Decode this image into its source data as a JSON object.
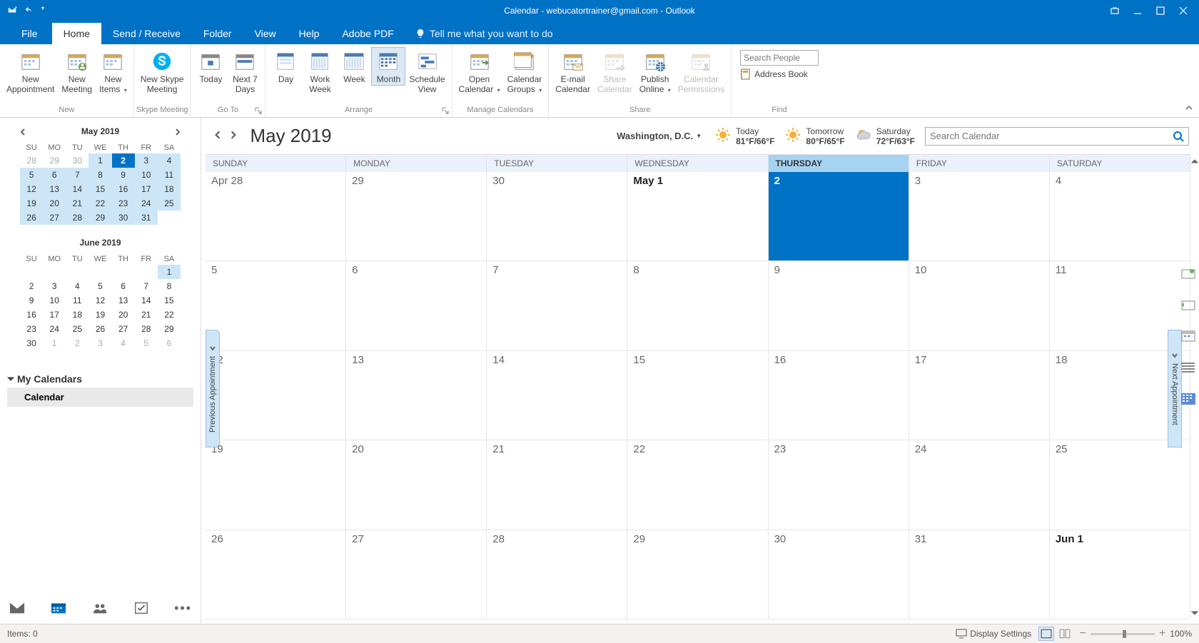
{
  "titlebar": {
    "title": "Calendar - webucatortrainer@gmail.com  -  Outlook"
  },
  "menu": {
    "tabs": [
      "File",
      "Home",
      "Send / Receive",
      "Folder",
      "View",
      "Help",
      "Adobe PDF"
    ],
    "active": 1,
    "tellme_placeholder": "Tell me what you want to do"
  },
  "ribbon": {
    "groups": {
      "new": {
        "label": "New",
        "buttons": [
          {
            "label": "New\nAppointment"
          },
          {
            "label": "New\nMeeting"
          },
          {
            "label": "New\nItems",
            "dropdown": true
          }
        ]
      },
      "skype": {
        "label": "Skype Meeting",
        "buttons": [
          {
            "label": "New Skype\nMeeting"
          }
        ]
      },
      "goto": {
        "label": "Go To",
        "buttons": [
          {
            "label": "Today"
          },
          {
            "label": "Next 7\nDays"
          }
        ]
      },
      "arrange": {
        "label": "Arrange",
        "buttons": [
          {
            "label": "Day"
          },
          {
            "label": "Work\nWeek"
          },
          {
            "label": "Week"
          },
          {
            "label": "Month",
            "selected": true
          },
          {
            "label": "Schedule\nView"
          }
        ]
      },
      "manage": {
        "label": "Manage Calendars",
        "buttons": [
          {
            "label": "Open\nCalendar",
            "dropdown": true
          },
          {
            "label": "Calendar\nGroups",
            "dropdown": true
          }
        ]
      },
      "share": {
        "label": "Share",
        "buttons": [
          {
            "label": "E-mail\nCalendar"
          },
          {
            "label": "Share\nCalendar",
            "disabled": true
          },
          {
            "label": "Publish\nOnline",
            "dropdown": true
          },
          {
            "label": "Calendar\nPermissions",
            "disabled": true
          }
        ]
      },
      "find": {
        "label": "Find",
        "search_placeholder": "Search People",
        "address_book": "Address Book"
      }
    }
  },
  "mini_cals": [
    {
      "title": "May 2019",
      "show_nav": true,
      "dow": [
        "SU",
        "MO",
        "TU",
        "WE",
        "TH",
        "FR",
        "SA"
      ],
      "weeks": [
        [
          {
            "d": "28",
            "oom": true
          },
          {
            "d": "29",
            "oom": true
          },
          {
            "d": "30",
            "oom": true
          },
          {
            "d": "1",
            "in": true
          },
          {
            "d": "2",
            "in": true,
            "today": true
          },
          {
            "d": "3",
            "in": true
          },
          {
            "d": "4",
            "in": true
          }
        ],
        [
          {
            "d": "5",
            "in": true
          },
          {
            "d": "6",
            "in": true
          },
          {
            "d": "7",
            "in": true
          },
          {
            "d": "8",
            "in": true
          },
          {
            "d": "9",
            "in": true
          },
          {
            "d": "10",
            "in": true
          },
          {
            "d": "11",
            "in": true
          }
        ],
        [
          {
            "d": "12",
            "in": true
          },
          {
            "d": "13",
            "in": true
          },
          {
            "d": "14",
            "in": true
          },
          {
            "d": "15",
            "in": true
          },
          {
            "d": "16",
            "in": true
          },
          {
            "d": "17",
            "in": true
          },
          {
            "d": "18",
            "in": true
          }
        ],
        [
          {
            "d": "19",
            "in": true
          },
          {
            "d": "20",
            "in": true
          },
          {
            "d": "21",
            "in": true
          },
          {
            "d": "22",
            "in": true
          },
          {
            "d": "23",
            "in": true
          },
          {
            "d": "24",
            "in": true
          },
          {
            "d": "25",
            "in": true
          }
        ],
        [
          {
            "d": "26",
            "in": true
          },
          {
            "d": "27",
            "in": true
          },
          {
            "d": "28",
            "in": true
          },
          {
            "d": "29",
            "in": true
          },
          {
            "d": "30",
            "in": true
          },
          {
            "d": "31",
            "in": true
          },
          {
            "d": ""
          }
        ]
      ]
    },
    {
      "title": "June 2019",
      "show_nav": false,
      "dow": [
        "SU",
        "MO",
        "TU",
        "WE",
        "TH",
        "FR",
        "SA"
      ],
      "weeks": [
        [
          {
            "d": ""
          },
          {
            "d": ""
          },
          {
            "d": ""
          },
          {
            "d": ""
          },
          {
            "d": ""
          },
          {
            "d": ""
          },
          {
            "d": "1",
            "in": true
          }
        ],
        [
          {
            "d": "2"
          },
          {
            "d": "3"
          },
          {
            "d": "4"
          },
          {
            "d": "5"
          },
          {
            "d": "6"
          },
          {
            "d": "7"
          },
          {
            "d": "8"
          }
        ],
        [
          {
            "d": "9"
          },
          {
            "d": "10"
          },
          {
            "d": "11"
          },
          {
            "d": "12"
          },
          {
            "d": "13"
          },
          {
            "d": "14"
          },
          {
            "d": "15"
          }
        ],
        [
          {
            "d": "16"
          },
          {
            "d": "17"
          },
          {
            "d": "18"
          },
          {
            "d": "19"
          },
          {
            "d": "20"
          },
          {
            "d": "21"
          },
          {
            "d": "22"
          }
        ],
        [
          {
            "d": "23"
          },
          {
            "d": "24"
          },
          {
            "d": "25"
          },
          {
            "d": "26"
          },
          {
            "d": "27"
          },
          {
            "d": "28"
          },
          {
            "d": "29"
          }
        ],
        [
          {
            "d": "30"
          },
          {
            "d": "1",
            "oom": true
          },
          {
            "d": "2",
            "oom": true
          },
          {
            "d": "3",
            "oom": true
          },
          {
            "d": "4",
            "oom": true
          },
          {
            "d": "5",
            "oom": true
          },
          {
            "d": "6",
            "oom": true
          }
        ]
      ]
    }
  ],
  "mycals": {
    "header": "My Calendars",
    "items": [
      "Calendar"
    ]
  },
  "cal": {
    "title": "May 2019",
    "location": "Washington,  D.C.",
    "weather": [
      {
        "label": "Today",
        "temps": "81°F/66°F",
        "icon": "sun"
      },
      {
        "label": "Tomorrow",
        "temps": "80°F/65°F",
        "icon": "sun"
      },
      {
        "label": "Saturday",
        "temps": "72°F/63°F",
        "icon": "cloudy"
      }
    ],
    "search_placeholder": "Search Calendar",
    "dow": [
      "SUNDAY",
      "MONDAY",
      "TUESDAY",
      "WEDNESDAY",
      "THURSDAY",
      "FRIDAY",
      "SATURDAY"
    ],
    "today_col": 4,
    "weeks": [
      [
        {
          "t": "Apr 28"
        },
        {
          "t": "29"
        },
        {
          "t": "30"
        },
        {
          "t": "May 1",
          "bold": true
        },
        {
          "t": "2",
          "today": true
        },
        {
          "t": "3"
        },
        {
          "t": "4"
        }
      ],
      [
        {
          "t": "5"
        },
        {
          "t": "6"
        },
        {
          "t": "7"
        },
        {
          "t": "8"
        },
        {
          "t": "9"
        },
        {
          "t": "10"
        },
        {
          "t": "11"
        }
      ],
      [
        {
          "t": "12"
        },
        {
          "t": "13"
        },
        {
          "t": "14"
        },
        {
          "t": "15"
        },
        {
          "t": "16"
        },
        {
          "t": "17"
        },
        {
          "t": "18"
        }
      ],
      [
        {
          "t": "19"
        },
        {
          "t": "20"
        },
        {
          "t": "21"
        },
        {
          "t": "22"
        },
        {
          "t": "23"
        },
        {
          "t": "24"
        },
        {
          "t": "25"
        }
      ],
      [
        {
          "t": "26"
        },
        {
          "t": "27"
        },
        {
          "t": "28"
        },
        {
          "t": "29"
        },
        {
          "t": "30"
        },
        {
          "t": "31"
        },
        {
          "t": "Jun 1",
          "bold": true
        }
      ]
    ],
    "prev_appt": "Previous Appointment",
    "next_appt": "Next Appointment"
  },
  "status": {
    "items": "Items: 0",
    "display_settings": "Display Settings",
    "zoom": "100%"
  }
}
